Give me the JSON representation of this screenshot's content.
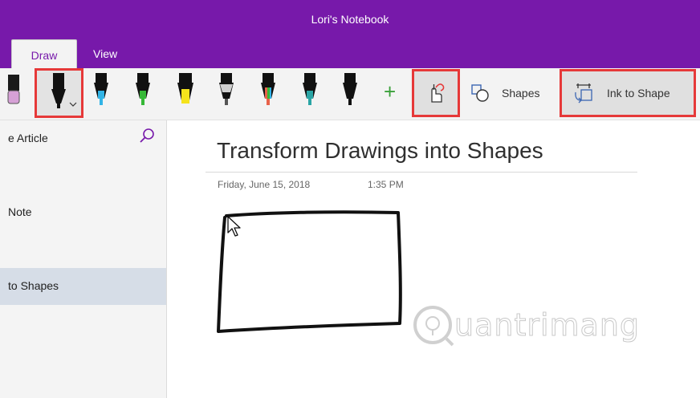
{
  "window": {
    "title": "Lori's Notebook"
  },
  "tabs": [
    {
      "label": "Draw",
      "active": true
    },
    {
      "label": "View",
      "active": false
    }
  ],
  "ribbon": {
    "pens": [
      {
        "name": "pink-highlighter",
        "color": "#d6a1d6"
      },
      {
        "name": "black-pen-selected",
        "color": "#111111"
      },
      {
        "name": "cyan-pen",
        "color": "#32b4e6"
      },
      {
        "name": "green-pen",
        "color": "#36b837"
      },
      {
        "name": "yellow-highlighter",
        "color": "#f5e31c"
      },
      {
        "name": "galaxy-pen",
        "color": "#9a9a9a"
      },
      {
        "name": "rainbow-pen",
        "color": "#e8624a"
      },
      {
        "name": "teal-pen",
        "color": "#2aa5a5"
      },
      {
        "name": "black-pen",
        "color": "#1a1a1a"
      }
    ],
    "shapes_label": "Shapes",
    "ink_to_shape_label": "Ink to Shape"
  },
  "sidebar": {
    "items": [
      {
        "label": "e Article",
        "selected": false
      },
      {
        "label": "Note",
        "selected": false
      },
      {
        "label": "to Shapes",
        "selected": true
      }
    ]
  },
  "page": {
    "title": "Transform Drawings into Shapes",
    "date": "Friday, June 15, 2018",
    "time": "1:35 PM"
  },
  "watermark": {
    "text": "uantrimang"
  },
  "colors": {
    "accent": "#7719aa",
    "highlight": "#e63939"
  }
}
